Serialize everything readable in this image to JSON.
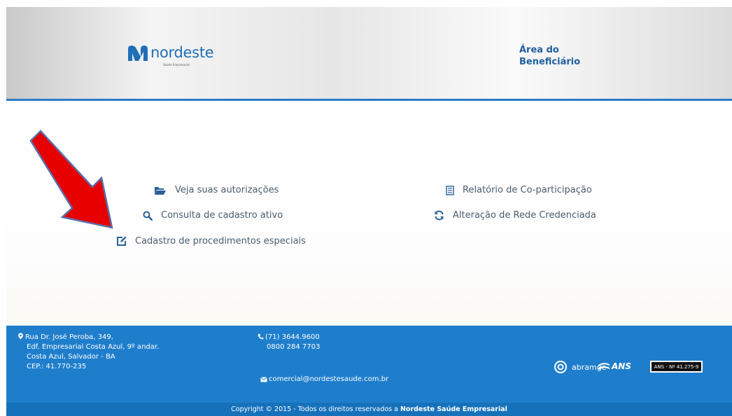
{
  "brand": {
    "name": "nordeste",
    "tagline": "Saúde Empresarial",
    "primary_color": "#1f7ecc",
    "accent_color": "#2b7dc4"
  },
  "header": {
    "area_line1": "Área do",
    "area_line2": "Beneficiário"
  },
  "menu": {
    "left": [
      {
        "label": "Veja suas autorizações",
        "icon": "folder-open-icon"
      },
      {
        "label": "Consulta de cadastro ativo",
        "icon": "search-icon"
      },
      {
        "label": "Cadastro de procedimentos especiais",
        "icon": "edit-icon"
      }
    ],
    "right": [
      {
        "label": "Relatório de Co-participação",
        "icon": "report-icon"
      },
      {
        "label": "Alteração de Rede Credenciada",
        "icon": "refresh-icon"
      }
    ]
  },
  "annotation": {
    "arrow_color": "#e60000",
    "icon": "red-arrow-icon"
  },
  "footer": {
    "address": {
      "line1": "Rua Dr. José Peroba, 349,",
      "line2": "Edf. Empresarial Costa Azul, 9º andar.",
      "line3": "Costa Azul, Salvador - BA",
      "line4": "CEP.: 41.770-235"
    },
    "phone1": "(71) 3644.9600",
    "phone2": "0800 284 7703",
    "email": "comercial@nordestesaude.com.br",
    "partner1": "abramge",
    "partner2": "ANS",
    "ans_registry": "ANS - Nº 41.275-9"
  },
  "copyright": {
    "text": "Copyright © 2015 - Todos os direitos reservados a",
    "company": "Nordeste Saúde Empresarial"
  }
}
